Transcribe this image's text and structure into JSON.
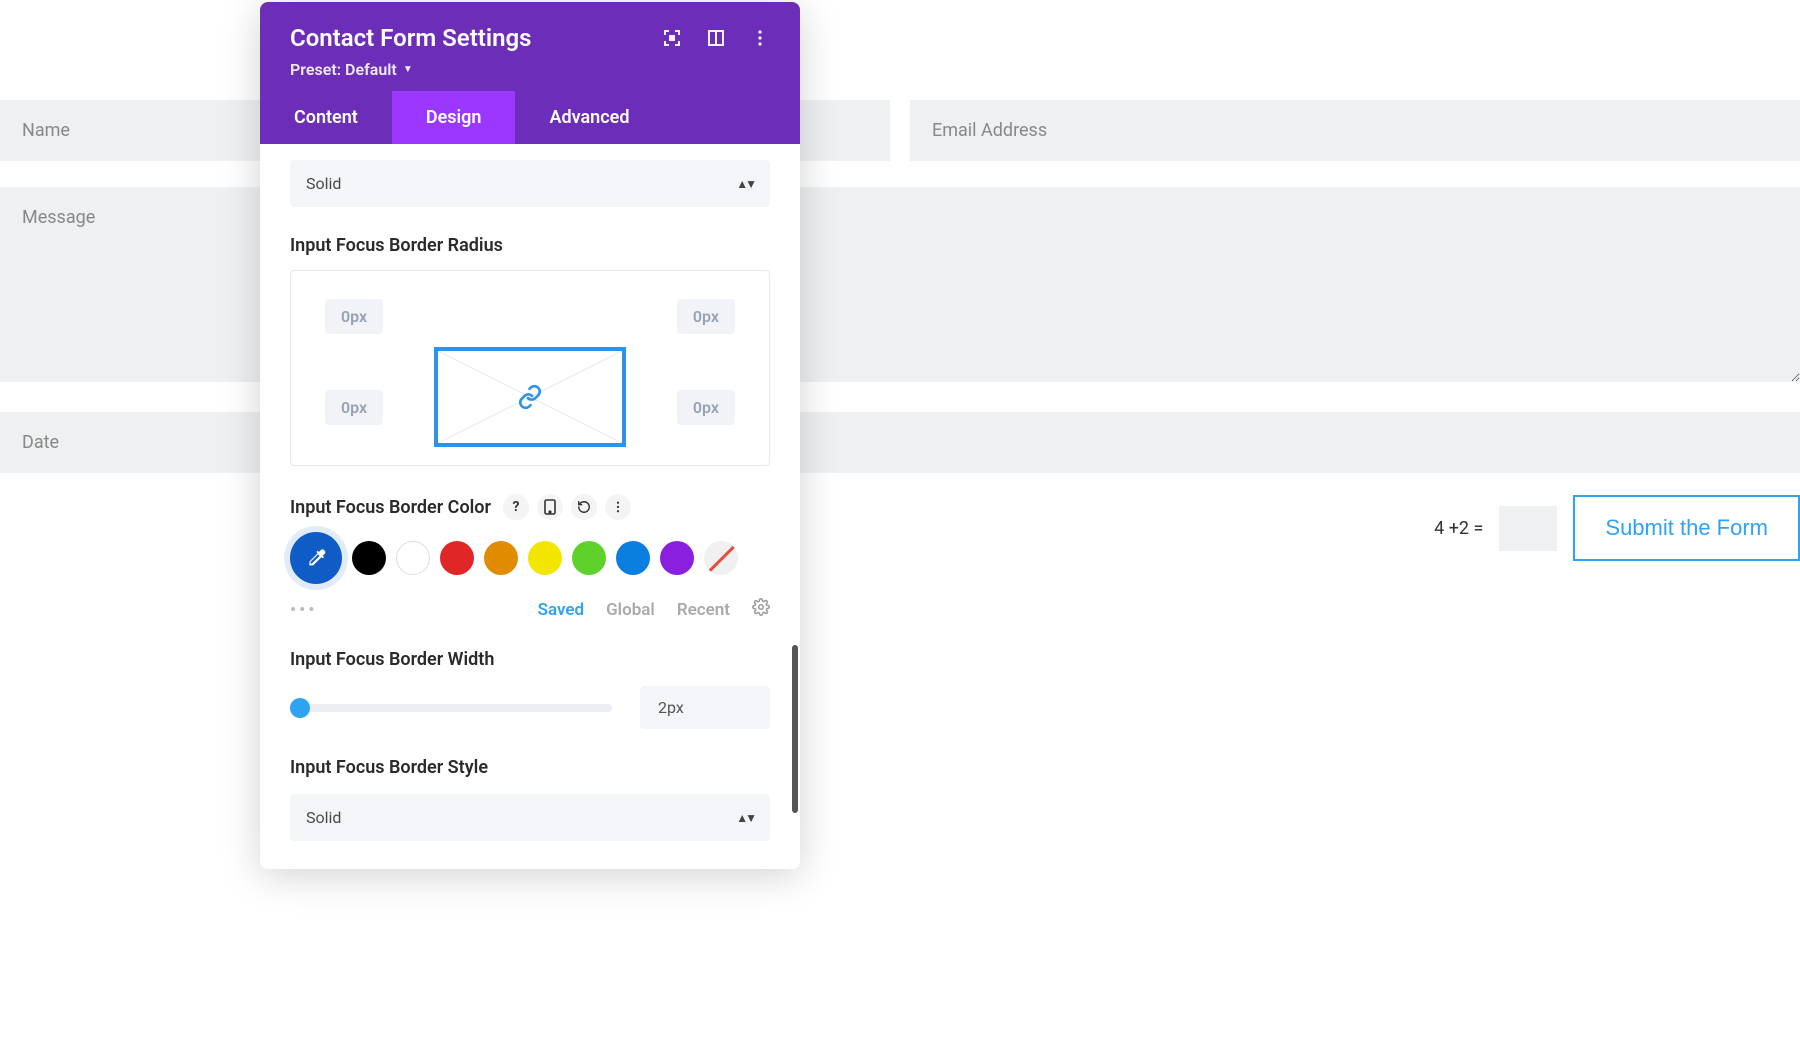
{
  "panel": {
    "title": "Contact Form Settings",
    "preset_label": "Preset: Default"
  },
  "tabs": {
    "content": "Content",
    "design": "Design",
    "advanced": "Advanced"
  },
  "select_top": "Solid",
  "sections": {
    "radius": {
      "label": "Input Focus Border Radius",
      "tl": "0px",
      "tr": "0px",
      "bl": "0px",
      "br": "0px"
    },
    "color": {
      "label": "Input Focus Border Color",
      "tabs": {
        "saved": "Saved",
        "global": "Global",
        "recent": "Recent"
      },
      "swatches": [
        "#000000",
        "#ffffff",
        "#e02626",
        "#e08b00",
        "#f2e600",
        "#5ed12b",
        "#0b7fe0",
        "#8a1fe0"
      ]
    },
    "width": {
      "label": "Input Focus Border Width",
      "value": "2px"
    },
    "style": {
      "label": "Input Focus Border Style",
      "value": "Solid"
    }
  },
  "form": {
    "name_ph": "Name",
    "email_ph": "Email Address",
    "message_ph": "Message",
    "date_ph": "Date",
    "captcha": "4 +2 =",
    "submit": "Submit the Form"
  }
}
